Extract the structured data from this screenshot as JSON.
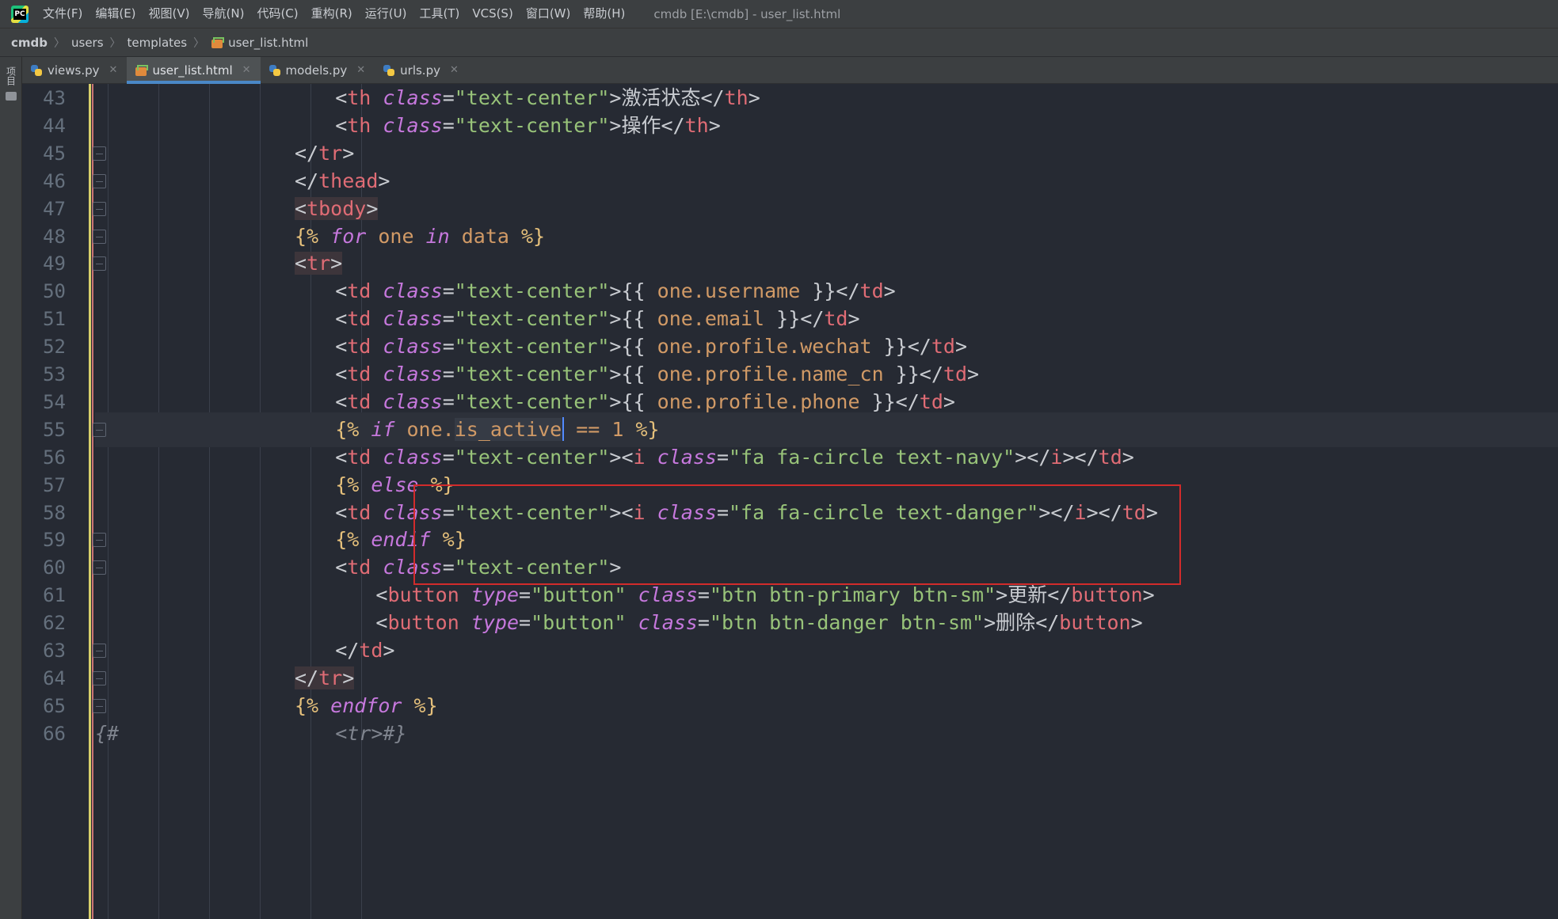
{
  "menubar": {
    "items": [
      "文件(F)",
      "编辑(E)",
      "视图(V)",
      "导航(N)",
      "代码(C)",
      "重构(R)",
      "运行(U)",
      "工具(T)",
      "VCS(S)",
      "窗口(W)",
      "帮助(H)"
    ],
    "window_title": "cmdb [E:\\cmdb] - user_list.html",
    "logo_text": "PC"
  },
  "breadcrumb": {
    "items": [
      "cmdb",
      "users",
      "templates",
      "user_list.html"
    ]
  },
  "left_strip": {
    "project_label": "项目"
  },
  "tabs": [
    {
      "label": "views.py",
      "icon": "python-file-icon",
      "active": false
    },
    {
      "label": "user_list.html",
      "icon": "html-file-icon",
      "active": true
    },
    {
      "label": "models.py",
      "icon": "python-file-icon",
      "active": false
    },
    {
      "label": "urls.py",
      "icon": "python-file-icon",
      "active": false
    }
  ],
  "editor": {
    "current_line": 55,
    "lines": [
      {
        "no": "43",
        "tokens": [
          [
            "punc",
            "<"
          ],
          [
            "tag",
            "th"
          ],
          [
            "text",
            " "
          ],
          [
            "attr",
            "class"
          ],
          [
            "punc",
            "="
          ],
          [
            "str",
            "\"text-center\""
          ],
          [
            "punc",
            ">"
          ],
          [
            "text",
            "激活状态"
          ],
          [
            "punc",
            "</"
          ],
          [
            "tag",
            "th"
          ],
          [
            "punc",
            ">"
          ]
        ]
      },
      {
        "no": "44",
        "tokens": [
          [
            "punc",
            "<"
          ],
          [
            "tag",
            "th"
          ],
          [
            "text",
            " "
          ],
          [
            "attr",
            "class"
          ],
          [
            "punc",
            "="
          ],
          [
            "str",
            "\"text-center\""
          ],
          [
            "punc",
            ">"
          ],
          [
            "text",
            "操作"
          ],
          [
            "punc",
            "</"
          ],
          [
            "tag",
            "th"
          ],
          [
            "punc",
            ">"
          ]
        ]
      },
      {
        "no": "45",
        "tokens": [
          [
            "punc",
            "</"
          ],
          [
            "tag",
            "tr"
          ],
          [
            "punc",
            ">"
          ]
        ]
      },
      {
        "no": "46",
        "tokens": [
          [
            "punc",
            "</"
          ],
          [
            "tag",
            "thead"
          ],
          [
            "punc",
            ">"
          ]
        ]
      },
      {
        "no": "47",
        "tokens": [
          [
            "punc",
            "<"
          ],
          [
            "tag",
            "tbody"
          ],
          [
            "punc",
            ">"
          ]
        ]
      },
      {
        "no": "48",
        "tokens": [
          [
            "tpl",
            "{% "
          ],
          [
            "kw",
            "for"
          ],
          [
            "var",
            " one "
          ],
          [
            "kw",
            "in"
          ],
          [
            "var",
            " data "
          ],
          [
            "tpl",
            "%}"
          ]
        ]
      },
      {
        "no": "49",
        "tokens": [
          [
            "punc",
            "<"
          ],
          [
            "tag",
            "tr"
          ],
          [
            "punc",
            ">"
          ]
        ]
      },
      {
        "no": "50",
        "tokens": [
          [
            "punc",
            "<"
          ],
          [
            "tag",
            "td"
          ],
          [
            "text",
            " "
          ],
          [
            "attr",
            "class"
          ],
          [
            "punc",
            "="
          ],
          [
            "str",
            "\"text-center\""
          ],
          [
            "punc",
            ">"
          ],
          [
            "text",
            "{{ "
          ],
          [
            "var",
            "one.username"
          ],
          [
            "text",
            " }}"
          ],
          [
            "punc",
            "</"
          ],
          [
            "tag",
            "td"
          ],
          [
            "punc",
            ">"
          ]
        ]
      },
      {
        "no": "51",
        "tokens": [
          [
            "punc",
            "<"
          ],
          [
            "tag",
            "td"
          ],
          [
            "text",
            " "
          ],
          [
            "attr",
            "class"
          ],
          [
            "punc",
            "="
          ],
          [
            "str",
            "\"text-center\""
          ],
          [
            "punc",
            ">"
          ],
          [
            "text",
            "{{ "
          ],
          [
            "var",
            "one.email"
          ],
          [
            "text",
            " }}"
          ],
          [
            "punc",
            "</"
          ],
          [
            "tag",
            "td"
          ],
          [
            "punc",
            ">"
          ]
        ]
      },
      {
        "no": "52",
        "tokens": [
          [
            "punc",
            "<"
          ],
          [
            "tag",
            "td"
          ],
          [
            "text",
            " "
          ],
          [
            "attr",
            "class"
          ],
          [
            "punc",
            "="
          ],
          [
            "str",
            "\"text-center\""
          ],
          [
            "punc",
            ">"
          ],
          [
            "text",
            "{{ "
          ],
          [
            "var",
            "one.profile.wechat"
          ],
          [
            "text",
            " }}"
          ],
          [
            "punc",
            "</"
          ],
          [
            "tag",
            "td"
          ],
          [
            "punc",
            ">"
          ]
        ]
      },
      {
        "no": "53",
        "tokens": [
          [
            "punc",
            "<"
          ],
          [
            "tag",
            "td"
          ],
          [
            "text",
            " "
          ],
          [
            "attr",
            "class"
          ],
          [
            "punc",
            "="
          ],
          [
            "str",
            "\"text-center\""
          ],
          [
            "punc",
            ">"
          ],
          [
            "text",
            "{{ "
          ],
          [
            "var",
            "one.profile.name_cn"
          ],
          [
            "text",
            " }}"
          ],
          [
            "punc",
            "</"
          ],
          [
            "tag",
            "td"
          ],
          [
            "punc",
            ">"
          ]
        ]
      },
      {
        "no": "54",
        "tokens": [
          [
            "punc",
            "<"
          ],
          [
            "tag",
            "td"
          ],
          [
            "text",
            " "
          ],
          [
            "attr",
            "class"
          ],
          [
            "punc",
            "="
          ],
          [
            "str",
            "\"text-center\""
          ],
          [
            "punc",
            ">"
          ],
          [
            "text",
            "{{ "
          ],
          [
            "var",
            "one.profile.phone"
          ],
          [
            "text",
            " }}"
          ],
          [
            "punc",
            "</"
          ],
          [
            "tag",
            "td"
          ],
          [
            "punc",
            ">"
          ]
        ]
      },
      {
        "no": "55",
        "tokens": [
          [
            "tpl",
            "{% "
          ],
          [
            "kw",
            "if"
          ],
          [
            "var",
            " one."
          ],
          [
            "var",
            "is_active"
          ],
          [
            "var",
            " == 1 "
          ],
          [
            "tpl",
            "%}"
          ]
        ]
      },
      {
        "no": "56",
        "tokens": [
          [
            "punc",
            "<"
          ],
          [
            "tag",
            "td"
          ],
          [
            "text",
            " "
          ],
          [
            "attr",
            "class"
          ],
          [
            "punc",
            "="
          ],
          [
            "str",
            "\"text-center\""
          ],
          [
            "punc",
            ">"
          ],
          [
            "punc",
            "<"
          ],
          [
            "tag",
            "i"
          ],
          [
            "text",
            " "
          ],
          [
            "attr",
            "class"
          ],
          [
            "punc",
            "="
          ],
          [
            "str",
            "\"fa fa-circle text-navy\""
          ],
          [
            "punc",
            ">"
          ],
          [
            "punc",
            "</"
          ],
          [
            "tag",
            "i"
          ],
          [
            "punc",
            ">"
          ],
          [
            "punc",
            "</"
          ],
          [
            "tag",
            "td"
          ],
          [
            "punc",
            ">"
          ]
        ]
      },
      {
        "no": "57",
        "tokens": [
          [
            "tpl",
            "{% "
          ],
          [
            "kw",
            "else"
          ],
          [
            "tpl",
            " %}"
          ]
        ]
      },
      {
        "no": "58",
        "tokens": [
          [
            "punc",
            "<"
          ],
          [
            "tag",
            "td"
          ],
          [
            "text",
            " "
          ],
          [
            "attr",
            "class"
          ],
          [
            "punc",
            "="
          ],
          [
            "str",
            "\"text-center\""
          ],
          [
            "punc",
            ">"
          ],
          [
            "punc",
            "<"
          ],
          [
            "tag",
            "i"
          ],
          [
            "text",
            " "
          ],
          [
            "attr",
            "class"
          ],
          [
            "punc",
            "="
          ],
          [
            "str",
            "\"fa fa-circle text-danger\""
          ],
          [
            "punc",
            ">"
          ],
          [
            "punc",
            "</"
          ],
          [
            "tag",
            "i"
          ],
          [
            "punc",
            ">"
          ],
          [
            "punc",
            "</"
          ],
          [
            "tag",
            "td"
          ],
          [
            "punc",
            ">"
          ]
        ]
      },
      {
        "no": "59",
        "tokens": [
          [
            "tpl",
            "{% "
          ],
          [
            "kw",
            "endif"
          ],
          [
            "tpl",
            " %}"
          ]
        ]
      },
      {
        "no": "60",
        "tokens": [
          [
            "punc",
            "<"
          ],
          [
            "tag",
            "td"
          ],
          [
            "text",
            " "
          ],
          [
            "attr",
            "class"
          ],
          [
            "punc",
            "="
          ],
          [
            "str",
            "\"text-center\""
          ],
          [
            "punc",
            ">"
          ]
        ]
      },
      {
        "no": "61",
        "tokens": [
          [
            "punc",
            "<"
          ],
          [
            "tag",
            "button"
          ],
          [
            "text",
            " "
          ],
          [
            "attr",
            "type"
          ],
          [
            "punc",
            "="
          ],
          [
            "str",
            "\"button\""
          ],
          [
            "text",
            " "
          ],
          [
            "attr",
            "class"
          ],
          [
            "punc",
            "="
          ],
          [
            "str",
            "\"btn btn-primary btn-sm\""
          ],
          [
            "punc",
            ">"
          ],
          [
            "text",
            "更新"
          ],
          [
            "punc",
            "</"
          ],
          [
            "tag",
            "button"
          ],
          [
            "punc",
            ">"
          ]
        ]
      },
      {
        "no": "62",
        "tokens": [
          [
            "punc",
            "<"
          ],
          [
            "tag",
            "button"
          ],
          [
            "text",
            " "
          ],
          [
            "attr",
            "type"
          ],
          [
            "punc",
            "="
          ],
          [
            "str",
            "\"button\""
          ],
          [
            "text",
            " "
          ],
          [
            "attr",
            "class"
          ],
          [
            "punc",
            "="
          ],
          [
            "str",
            "\"btn btn-danger btn-sm\""
          ],
          [
            "punc",
            ">"
          ],
          [
            "text",
            "删除"
          ],
          [
            "punc",
            "</"
          ],
          [
            "tag",
            "button"
          ],
          [
            "punc",
            ">"
          ]
        ]
      },
      {
        "no": "63",
        "tokens": [
          [
            "punc",
            "</"
          ],
          [
            "tag",
            "td"
          ],
          [
            "punc",
            ">"
          ]
        ]
      },
      {
        "no": "64",
        "tokens": [
          [
            "punc",
            "</"
          ],
          [
            "tag",
            "tr"
          ],
          [
            "punc",
            ">"
          ]
        ]
      },
      {
        "no": "65",
        "tokens": [
          [
            "tpl",
            "{% "
          ],
          [
            "kw",
            "endfor"
          ],
          [
            "tpl",
            " %}"
          ]
        ]
      },
      {
        "no": "66",
        "tokens": [
          [
            "cmt",
            "<tr>#}"
          ]
        ]
      }
    ],
    "line_66_prefix": "{#"
  },
  "colors": {
    "editor_bg": "#262a33",
    "tag": "#e06c75",
    "attribute": "#c678dd",
    "string": "#98c379",
    "template": "#e5c07b",
    "highlight_box": "#d22b2b",
    "active_tab_underline": "#4a88c7"
  }
}
